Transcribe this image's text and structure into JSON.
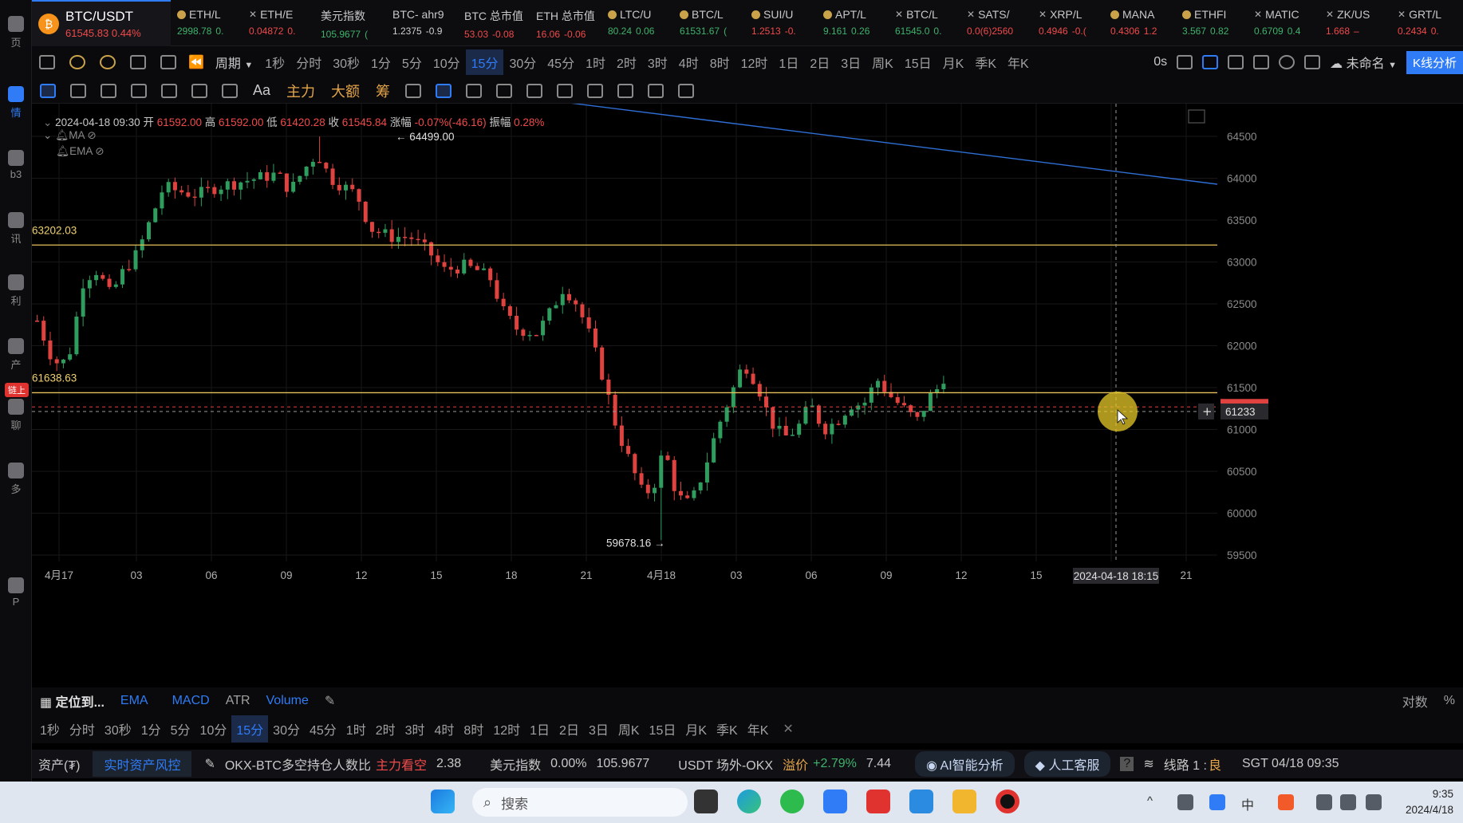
{
  "rail": {
    "items": [
      {
        "label": "页",
        "icon": "home-icon"
      },
      {
        "label": "情",
        "icon": "market-icon",
        "active": true
      },
      {
        "label": "b3",
        "icon": "web3-icon"
      },
      {
        "label": "讯",
        "icon": "news-icon"
      },
      {
        "label": "利",
        "icon": "earn-icon"
      },
      {
        "label": "产",
        "icon": "asset-icon"
      },
      {
        "label": "聊",
        "icon": "chat-icon"
      },
      {
        "label": "多",
        "icon": "more-icon"
      },
      {
        "label": "P",
        "icon": "vip-icon"
      }
    ],
    "badge": "链上"
  },
  "tickers": {
    "primary": {
      "symbol": "BTC/USDT",
      "price": "61545.83",
      "change": "0.44%"
    },
    "items": [
      {
        "name": "ETH/L",
        "price": "2998.78",
        "change": "0.",
        "dir": "up",
        "mark": "dot"
      },
      {
        "name": "ETH/E",
        "price": "0.04872",
        "change": "0.",
        "dir": "down",
        "mark": "x"
      },
      {
        "name": "美元指数",
        "price": "105.9677",
        "change": "(",
        "dir": "up",
        "mark": "none"
      },
      {
        "name": "BTC- ahr9",
        "price": "1.2375",
        "change": "-0.9",
        "dir": "white",
        "mark": "none"
      },
      {
        "name": "BTC 总市值",
        "price": "53.03",
        "change": "-0.08",
        "dir": "down",
        "mark": "none"
      },
      {
        "name": "ETH 总市值",
        "price": "16.06",
        "change": "-0.06",
        "dir": "down",
        "mark": "none"
      },
      {
        "name": "LTC/U",
        "price": "80.24",
        "change": "0.06",
        "dir": "up",
        "mark": "dot"
      },
      {
        "name": "BTC/L",
        "price": "61531.67",
        "change": "(",
        "dir": "up",
        "mark": "dot"
      },
      {
        "name": "SUI/U",
        "price": "1.2513",
        "change": "-0.",
        "dir": "down",
        "mark": "dot"
      },
      {
        "name": "APT/L",
        "price": "9.161",
        "change": "0.26",
        "dir": "up",
        "mark": "dot"
      },
      {
        "name": "BTC/L",
        "price": "61545.0",
        "change": "0.",
        "dir": "up",
        "mark": "x"
      },
      {
        "name": "SATS/",
        "price": "0.0(6)2560",
        "change": "",
        "dir": "down",
        "mark": "x"
      },
      {
        "name": "XRP/L",
        "price": "0.4946",
        "change": "-0.(",
        "dir": "down",
        "mark": "x"
      },
      {
        "name": "MANA",
        "price": "0.4306",
        "change": "1.2",
        "dir": "down",
        "mark": "dot"
      },
      {
        "name": "ETHFI",
        "price": "3.567",
        "change": "0.82",
        "dir": "up",
        "mark": "dot"
      },
      {
        "name": "MATIC",
        "price": "0.6709",
        "change": "0.4",
        "dir": "up",
        "mark": "x"
      },
      {
        "name": "ZK/US",
        "price": "1.668",
        "change": "–",
        "dir": "down",
        "mark": "x"
      },
      {
        "name": "GRT/L",
        "price": "0.2434",
        "change": "0.",
        "dir": "down",
        "mark": "x"
      }
    ]
  },
  "interval_bar": {
    "period_label": "周期",
    "intervals": [
      "1秒",
      "分时",
      "30秒",
      "1分",
      "5分",
      "10分",
      "15分",
      "30分",
      "45分",
      "1时",
      "2时",
      "3时",
      "4时",
      "8时",
      "12时",
      "1日",
      "2日",
      "3日",
      "周K",
      "15日",
      "月K",
      "季K",
      "年K"
    ],
    "active": "15分",
    "countdown": "0s",
    "layout_name": "未命名",
    "kline_analysis": "K线分析"
  },
  "draw_bar": {
    "text_tools": [
      "Aa",
      "主力",
      "大额",
      "筹"
    ]
  },
  "ohlc": {
    "datetime": "2024-04-18 09:30",
    "open_label": "开",
    "open": "61592.00",
    "high_label": "高",
    "high": "61592.00",
    "low_label": "低",
    "low": "61420.28",
    "close_label": "收",
    "close": "61545.84",
    "change_label": "涨幅",
    "change": "-0.07%(-46.16)",
    "amp_label": "振幅",
    "amp": "0.28%",
    "ma_label": "MA",
    "ema_label": "EMA"
  },
  "chart_data": {
    "type": "candlestick",
    "interval": "15分",
    "price_axis_ticks": [
      "64500",
      "64000",
      "63500",
      "63000",
      "62500",
      "62000",
      "61500",
      "61000",
      "60500",
      "60000",
      "59500"
    ],
    "time_axis_ticks": [
      "4月17",
      "03",
      "06",
      "09",
      "12",
      "15",
      "18",
      "21",
      "4月18",
      "03",
      "06",
      "09",
      "12",
      "15",
      "18",
      "21"
    ],
    "high_marker": "← 64499.00",
    "low_marker": "59678.16 →",
    "horizontal_levels": [
      {
        "label": "63202.03",
        "price": 63202.03,
        "color": "#e6c15a"
      },
      {
        "label": "61638.63",
        "price": 61638.63,
        "color": "#e6c15a"
      }
    ],
    "last_price_tag": "61545",
    "crosshair_price_tag": "61233",
    "crosshair_time_tag": "2024-04-18 18:15",
    "trend_line_color": "#2f6fd6",
    "up_color": "#2e9d5e",
    "down_color": "#e0433f"
  },
  "bottom_tabs": {
    "locate": "定位到...",
    "items": [
      "EMA",
      "MACD",
      "ATR",
      "Volume"
    ],
    "right": [
      "对数",
      "%"
    ]
  },
  "bottom_intervals": {
    "items": [
      "1秒",
      "分时",
      "30秒",
      "1分",
      "5分",
      "10分",
      "15分",
      "30分",
      "45分",
      "1时",
      "2时",
      "3时",
      "4时",
      "8时",
      "12时",
      "1日",
      "2日",
      "3日",
      "周K",
      "15日",
      "月K",
      "季K",
      "年K"
    ],
    "active": "15分"
  },
  "status_bar": {
    "asset": "资产(₮)",
    "risk": "实时资产风控",
    "ratio_label": "OKX-BTC多空持仓人数比",
    "ratio_tag": "主力看空",
    "ratio_value": "2.38",
    "dxy_label": "美元指数",
    "dxy_change": "0.00%",
    "dxy_value": "105.9677",
    "otc_label": "USDT 场外-OKX",
    "premium_label": "溢价",
    "premium_change": "+2.79%",
    "premium_value": "7.44",
    "ai_btn": "AI智能分析",
    "cs_btn": "人工客服",
    "line_label": "线路 1 :",
    "line_quality": "良",
    "tz_time": "SGT  04/18 09:35"
  },
  "taskbar": {
    "search_placeholder": "搜索",
    "time": "9:35",
    "date": "2024/4/18",
    "ime": "中"
  }
}
